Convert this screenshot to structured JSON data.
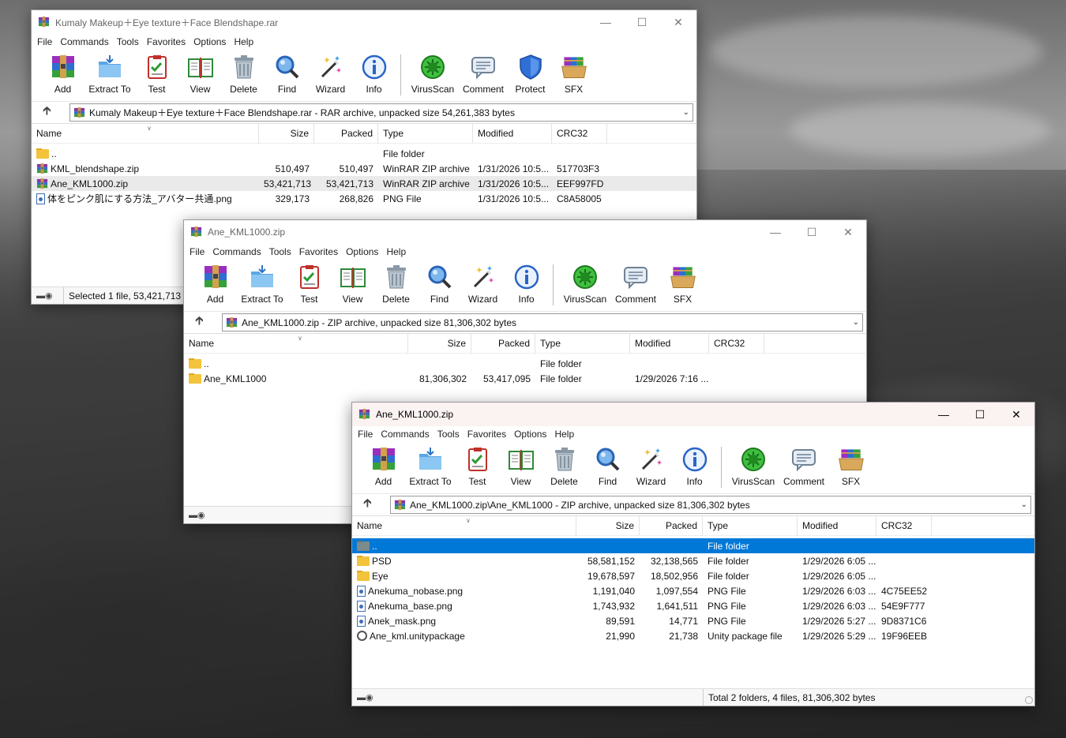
{
  "menu": [
    "File",
    "Commands",
    "Tools",
    "Favorites",
    "Options",
    "Help"
  ],
  "toolbar": [
    {
      "label": "Add",
      "icon": "add-icon"
    },
    {
      "label": "Extract To",
      "icon": "extract-to-icon"
    },
    {
      "label": "Test",
      "icon": "test-icon"
    },
    {
      "label": "View",
      "icon": "view-icon"
    },
    {
      "label": "Delete",
      "icon": "delete-icon"
    },
    {
      "label": "Find",
      "icon": "find-icon"
    },
    {
      "label": "Wizard",
      "icon": "wizard-icon"
    },
    {
      "label": "Info",
      "icon": "info-icon"
    },
    {
      "label": "VirusScan",
      "icon": "virusscan-icon"
    },
    {
      "label": "Comment",
      "icon": "comment-icon"
    },
    {
      "label": "Protect",
      "icon": "protect-icon"
    },
    {
      "label": "SFX",
      "icon": "sfx-icon"
    }
  ],
  "columns": {
    "name": "Name",
    "size": "Size",
    "packed": "Packed",
    "type": "Type",
    "modified": "Modified",
    "crc": "CRC32"
  },
  "win1": {
    "title": "Kumaly Makeup＋Eye texture＋Face Blendshape.rar",
    "address": "Kumaly Makeup＋Eye texture＋Face Blendshape.rar - RAR archive, unpacked size 54,261,383 bytes",
    "status": "Selected 1 file, 53,421,713 bytes",
    "rows": [
      {
        "name": "..",
        "size": "",
        "packed": "",
        "type": "File folder",
        "modified": "",
        "crc": ""
      },
      {
        "name": "KML_blendshape.zip",
        "size": "510,497",
        "packed": "510,497",
        "type": "WinRAR ZIP archive",
        "modified": "1/31/2026 10:5...",
        "crc": "517703F3"
      },
      {
        "name": "Ane_KML1000.zip",
        "size": "53,421,713",
        "packed": "53,421,713",
        "type": "WinRAR ZIP archive",
        "modified": "1/31/2026 10:5...",
        "crc": "EEF997FD"
      },
      {
        "name": "体をピンク肌にする方法_アバター共通.png",
        "size": "329,173",
        "packed": "268,826",
        "type": "PNG File",
        "modified": "1/31/2026 10:5...",
        "crc": "C8A58005"
      }
    ]
  },
  "win2": {
    "title": "Ane_KML1000.zip",
    "address": "Ane_KML1000.zip - ZIP archive, unpacked size 81,306,302 bytes",
    "rows": [
      {
        "name": "..",
        "size": "",
        "packed": "",
        "type": "File folder",
        "modified": "",
        "crc": ""
      },
      {
        "name": "Ane_KML1000",
        "size": "81,306,302",
        "packed": "53,417,095",
        "type": "File folder",
        "modified": "1/29/2026 7:16 ...",
        "crc": ""
      }
    ]
  },
  "win3": {
    "title": "Ane_KML1000.zip",
    "address": "Ane_KML1000.zip\\Ane_KML1000 - ZIP archive, unpacked size 81,306,302 bytes",
    "status": "Total 2 folders, 4 files, 81,306,302 bytes",
    "rows": [
      {
        "name": "..",
        "size": "",
        "packed": "",
        "type": "File folder",
        "modified": "",
        "crc": ""
      },
      {
        "name": "PSD",
        "size": "58,581,152",
        "packed": "32,138,565",
        "type": "File folder",
        "modified": "1/29/2026 6:05 ...",
        "crc": ""
      },
      {
        "name": "Eye",
        "size": "19,678,597",
        "packed": "18,502,956",
        "type": "File folder",
        "modified": "1/29/2026 6:05 ...",
        "crc": ""
      },
      {
        "name": "Anekuma_nobase.png",
        "size": "1,191,040",
        "packed": "1,097,554",
        "type": "PNG File",
        "modified": "1/29/2026 6:03 ...",
        "crc": "4C75EE52"
      },
      {
        "name": "Anekuma_base.png",
        "size": "1,743,932",
        "packed": "1,641,511",
        "type": "PNG File",
        "modified": "1/29/2026 6:03 ...",
        "crc": "54E9F777"
      },
      {
        "name": "Anek_mask.png",
        "size": "89,591",
        "packed": "14,771",
        "type": "PNG File",
        "modified": "1/29/2026 5:27 ...",
        "crc": "9D8371C6"
      },
      {
        "name": "Ane_kml.unitypackage",
        "size": "21,990",
        "packed": "21,738",
        "type": "Unity package file",
        "modified": "1/29/2026 5:29 ...",
        "crc": "19F96EEB"
      }
    ]
  }
}
